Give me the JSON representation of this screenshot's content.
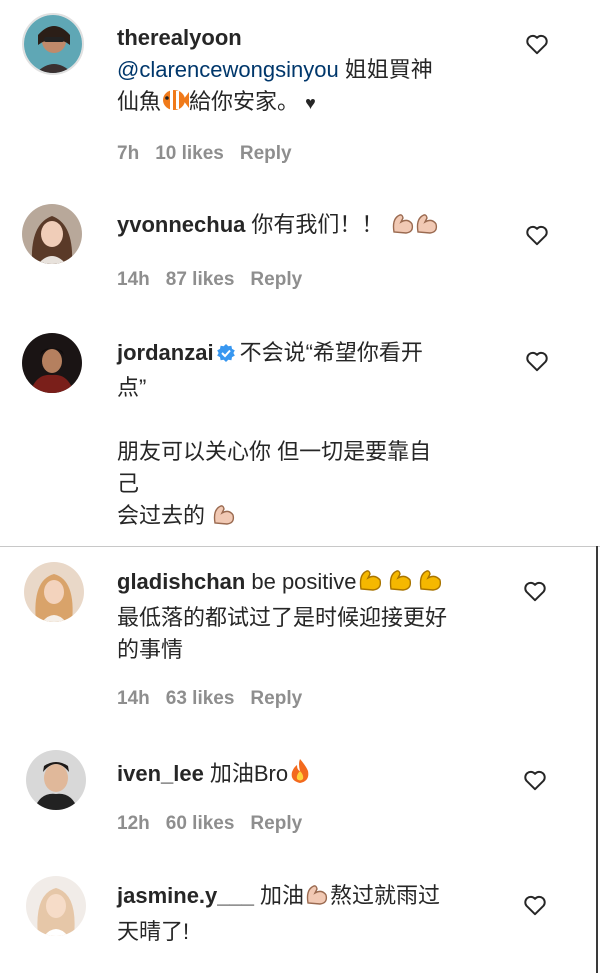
{
  "comments": [
    {
      "username": "therealyoon",
      "mention": "@clarencewongsinyou",
      "line1_rest": " 姐姐買神",
      "line2": "仙魚",
      "line2_rest": "給你安家。",
      "icon_fish": "tropical-fish-emoji",
      "icon_heart_small": "black-heart-emoji",
      "heart_small_char": "♥",
      "time": "7h",
      "likes": "10 likes",
      "reply": "Reply"
    },
    {
      "username": "yvonnechua",
      "text": "你有我们！！",
      "icon": "flexed-biceps-emoji",
      "time": "14h",
      "likes": "87 likes",
      "reply": "Reply"
    },
    {
      "username": "jordanzai",
      "verified_icon": "verified-badge-icon",
      "line1": "不会说“希望你看开",
      "line2": "点”",
      "line3": "朋友可以关心你 但一切是要靠自",
      "line4": "己",
      "line5": "会过去的",
      "icon": "flexed-biceps-emoji"
    },
    {
      "username": "gladishchan",
      "line1": "be positive",
      "line2": "最低落的都试过了是时候迎接更好",
      "line3": "的事情",
      "icon": "flexed-biceps-emoji",
      "time": "14h",
      "likes": "63 likes",
      "reply": "Reply"
    },
    {
      "username": "iven_lee",
      "text": "加油Bro",
      "icon": "fire-emoji",
      "time": "12h",
      "likes": "60 likes",
      "reply": "Reply"
    },
    {
      "username": "jasmine.y___",
      "text_a": "加油",
      "text_b": "熬过就雨过",
      "line2": "天晴了!",
      "icon": "flexed-biceps-emoji"
    }
  ],
  "colors": {
    "username": "#262626",
    "mention": "#00376b",
    "meta": "#8e8e8e",
    "verified": "#3897f0",
    "biceps_light": "#f1c9b4",
    "biceps_yellow": "#f5b800"
  }
}
